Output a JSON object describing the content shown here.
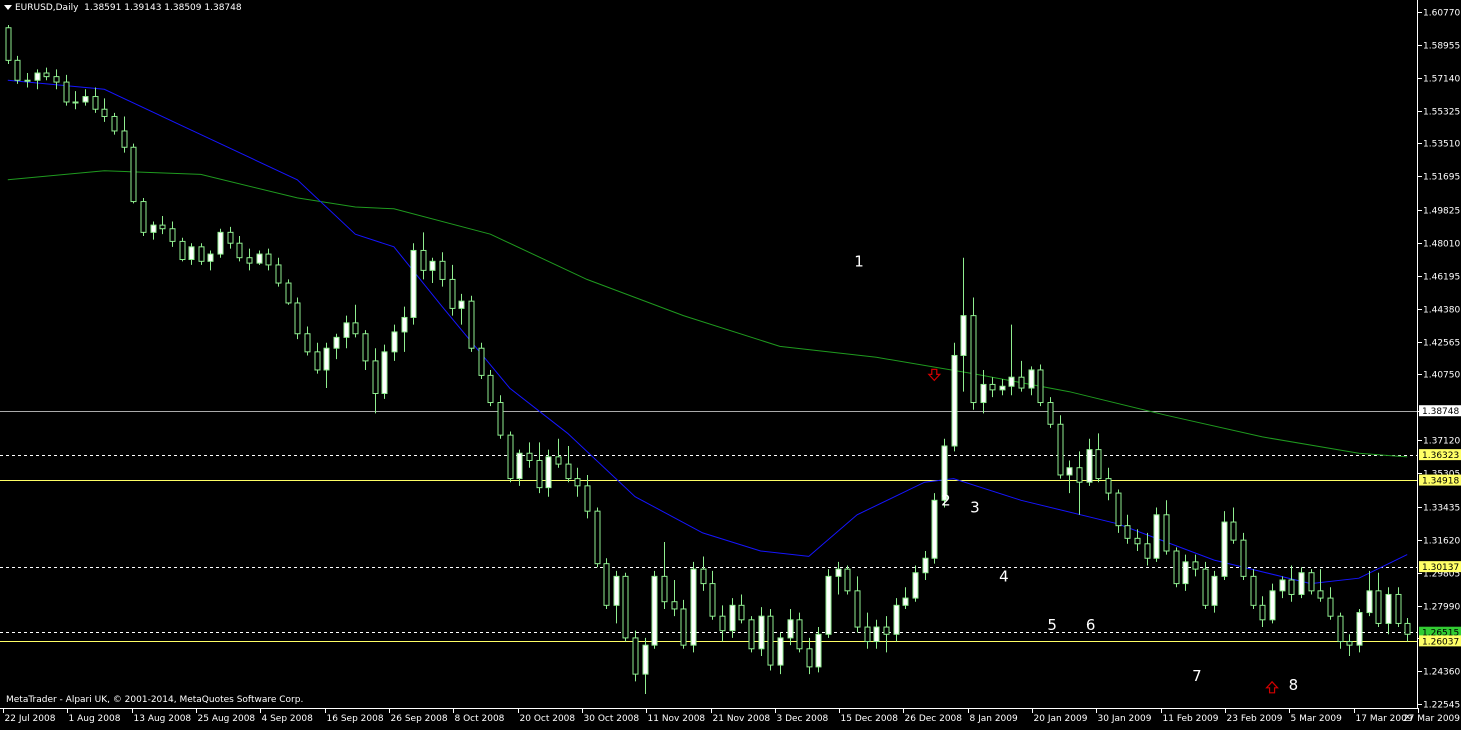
{
  "header": {
    "symbol": "EURUSD,Daily",
    "ohlc": "1.38591 1.39143 1.38509 1.38748"
  },
  "footer": {
    "copyright": "MetaTrader - Alpari UK, © 2001-2014, MetaQuotes Software Corp."
  },
  "colors": {
    "background": "#000000",
    "candle_bull": "#ffffff",
    "candle_bear": "#90ee90",
    "wick": "#90ee90",
    "ma_fast": "#1515ff",
    "ma_slow": "#1f9a1f",
    "hline_solid": "#aaaaaa",
    "hline_yellow": "#ffff66",
    "price_tag_yellow": "#ffff66",
    "price_tag_green": "#33cc33",
    "arrow_red": "#d00000"
  },
  "chart_data": {
    "type": "candlestick",
    "ylim": [
      1.2255,
      1.6077
    ],
    "y_ticks": [
      "1.60770",
      "1.58955",
      "1.57140",
      "1.55325",
      "1.53510",
      "1.51695",
      "1.49825",
      "1.48010",
      "1.46195",
      "1.44380",
      "1.42565",
      "1.40750",
      "1.38748",
      "1.37120",
      "1.35305",
      "1.33435",
      "1.31620",
      "1.29805",
      "1.27990",
      "1.26175",
      "1.24360",
      "1.22545"
    ],
    "x_ticks": [
      "22 Jul 2008",
      "1 Aug 2008",
      "13 Aug 2008",
      "25 Aug 2008",
      "4 Sep 2008",
      "16 Sep 2008",
      "26 Sep 2008",
      "8 Oct 2008",
      "20 Oct 2008",
      "30 Oct 2008",
      "11 Nov 2008",
      "21 Nov 2008",
      "3 Dec 2008",
      "15 Dec 2008",
      "26 Dec 2008",
      "8 Jan 2009",
      "20 Jan 2009",
      "30 Jan 2009",
      "11 Feb 2009",
      "23 Feb 2009",
      "5 Mar 2009",
      "17 Mar 2009",
      "27 Mar 2009"
    ],
    "price_tags": [
      {
        "label": "1.38748",
        "value": 1.38748,
        "style": "current"
      },
      {
        "label": "1.36323",
        "value": 1.36323,
        "style": "yellow"
      },
      {
        "label": "1.34918",
        "value": 1.34918,
        "style": "yellow"
      },
      {
        "label": "1.30137",
        "value": 1.30137,
        "style": "yellow"
      },
      {
        "label": "1.26515",
        "value": 1.26515,
        "style": "green"
      },
      {
        "label": "1.26037",
        "value": 1.26037,
        "style": "yellow"
      }
    ],
    "hlines": [
      {
        "value": 1.38748,
        "style": "solid-gray"
      },
      {
        "value": 1.36323,
        "style": "dashed"
      },
      {
        "value": 1.34918,
        "style": "solid-yellow"
      },
      {
        "value": 1.30137,
        "style": "dashed"
      },
      {
        "value": 1.26515,
        "style": "dashed"
      },
      {
        "value": 1.26037,
        "style": "solid-yellow"
      }
    ],
    "annotations": [
      {
        "text": "1",
        "date_index": 88,
        "price": 1.47
      },
      {
        "text": "2",
        "date_index": 97,
        "price": 1.338
      },
      {
        "text": "3",
        "date_index": 100,
        "price": 1.334
      },
      {
        "text": "4",
        "date_index": 103,
        "price": 1.296
      },
      {
        "text": "5",
        "date_index": 108,
        "price": 1.269
      },
      {
        "text": "6",
        "date_index": 112,
        "price": 1.269
      },
      {
        "text": "7",
        "date_index": 123,
        "price": 1.241
      },
      {
        "text": "8",
        "date_index": 133,
        "price": 1.236
      }
    ],
    "arrows": [
      {
        "direction": "down",
        "date_index": 96,
        "price": 1.407
      },
      {
        "direction": "up",
        "date_index": 131,
        "price": 1.235
      }
    ],
    "ma_fast": [
      [
        0,
        1.57
      ],
      [
        10,
        1.565
      ],
      [
        20,
        1.54
      ],
      [
        30,
        1.515
      ],
      [
        36,
        1.485
      ],
      [
        40,
        1.478
      ],
      [
        45,
        1.445
      ],
      [
        52,
        1.4
      ],
      [
        58,
        1.375
      ],
      [
        65,
        1.34
      ],
      [
        72,
        1.32
      ],
      [
        78,
        1.31
      ],
      [
        83,
        1.307
      ],
      [
        88,
        1.33
      ],
      [
        95,
        1.348
      ],
      [
        98,
        1.35
      ],
      [
        105,
        1.338
      ],
      [
        115,
        1.325
      ],
      [
        125,
        1.305
      ],
      [
        135,
        1.292
      ],
      [
        140,
        1.295
      ],
      [
        145,
        1.308
      ]
    ],
    "ma_slow": [
      [
        0,
        1.515
      ],
      [
        10,
        1.52
      ],
      [
        20,
        1.518
      ],
      [
        30,
        1.505
      ],
      [
        36,
        1.5
      ],
      [
        40,
        1.499
      ],
      [
        50,
        1.485
      ],
      [
        60,
        1.46
      ],
      [
        70,
        1.44
      ],
      [
        80,
        1.423
      ],
      [
        90,
        1.417
      ],
      [
        100,
        1.408
      ],
      [
        110,
        1.398
      ],
      [
        120,
        1.385
      ],
      [
        130,
        1.373
      ],
      [
        140,
        1.364
      ],
      [
        145,
        1.362
      ]
    ],
    "candles": [
      [
        1.599,
        1.6005,
        1.579,
        1.581
      ],
      [
        1.581,
        1.5835,
        1.568,
        1.57
      ],
      [
        1.57,
        1.574,
        1.566,
        1.57
      ],
      [
        1.57,
        1.576,
        1.565,
        1.574
      ],
      [
        1.574,
        1.577,
        1.57,
        1.572
      ],
      [
        1.572,
        1.576,
        1.565,
        1.569
      ],
      [
        1.569,
        1.573,
        1.556,
        1.558
      ],
      [
        1.558,
        1.564,
        1.554,
        1.558
      ],
      [
        1.558,
        1.565,
        1.556,
        1.561
      ],
      [
        1.561,
        1.566,
        1.552,
        1.554
      ],
      [
        1.554,
        1.56,
        1.547,
        1.55
      ],
      [
        1.55,
        1.552,
        1.54,
        1.542
      ],
      [
        1.542,
        1.55,
        1.53,
        1.533
      ],
      [
        1.533,
        1.535,
        1.502,
        1.503
      ],
      [
        1.503,
        1.505,
        1.484,
        1.486
      ],
      [
        1.486,
        1.492,
        1.482,
        1.49
      ],
      [
        1.49,
        1.495,
        1.485,
        1.488
      ],
      [
        1.488,
        1.492,
        1.478,
        1.481
      ],
      [
        1.481,
        1.483,
        1.47,
        1.471
      ],
      [
        1.471,
        1.48,
        1.468,
        1.478
      ],
      [
        1.478,
        1.48,
        1.468,
        1.47
      ],
      [
        1.47,
        1.476,
        1.465,
        1.474
      ],
      [
        1.474,
        1.488,
        1.472,
        1.486
      ],
      [
        1.486,
        1.489,
        1.477,
        1.48
      ],
      [
        1.48,
        1.484,
        1.47,
        1.472
      ],
      [
        1.472,
        1.477,
        1.465,
        1.469
      ],
      [
        1.469,
        1.476,
        1.468,
        1.474
      ],
      [
        1.474,
        1.477,
        1.465,
        1.468
      ],
      [
        1.468,
        1.472,
        1.456,
        1.458
      ],
      [
        1.458,
        1.46,
        1.446,
        1.447
      ],
      [
        1.447,
        1.45,
        1.427,
        1.43
      ],
      [
        1.43,
        1.434,
        1.418,
        1.42
      ],
      [
        1.42,
        1.425,
        1.408,
        1.41
      ],
      [
        1.41,
        1.425,
        1.4,
        1.422
      ],
      [
        1.422,
        1.43,
        1.416,
        1.428
      ],
      [
        1.428,
        1.44,
        1.422,
        1.436
      ],
      [
        1.436,
        1.446,
        1.428,
        1.43
      ],
      [
        1.43,
        1.432,
        1.41,
        1.415
      ],
      [
        1.415,
        1.422,
        1.386,
        1.397
      ],
      [
        1.397,
        1.424,
        1.394,
        1.42
      ],
      [
        1.42,
        1.435,
        1.415,
        1.431
      ],
      [
        1.431,
        1.445,
        1.42,
        1.439
      ],
      [
        1.439,
        1.48,
        1.435,
        1.476
      ],
      [
        1.476,
        1.486,
        1.46,
        1.465
      ],
      [
        1.465,
        1.472,
        1.458,
        1.47
      ],
      [
        1.47,
        1.475,
        1.456,
        1.46
      ],
      [
        1.46,
        1.468,
        1.44,
        1.444
      ],
      [
        1.444,
        1.452,
        1.435,
        1.448
      ],
      [
        1.448,
        1.451,
        1.42,
        1.422
      ],
      [
        1.422,
        1.425,
        1.405,
        1.407
      ],
      [
        1.407,
        1.41,
        1.39,
        1.392
      ],
      [
        1.392,
        1.396,
        1.372,
        1.374
      ],
      [
        1.374,
        1.376,
        1.348,
        1.35
      ],
      [
        1.35,
        1.366,
        1.346,
        1.364
      ],
      [
        1.364,
        1.37,
        1.356,
        1.36
      ],
      [
        1.36,
        1.37,
        1.342,
        1.345
      ],
      [
        1.345,
        1.366,
        1.34,
        1.362
      ],
      [
        1.362,
        1.372,
        1.356,
        1.358
      ],
      [
        1.358,
        1.368,
        1.348,
        1.35
      ],
      [
        1.35,
        1.356,
        1.34,
        1.346
      ],
      [
        1.346,
        1.352,
        1.328,
        1.332
      ],
      [
        1.332,
        1.334,
        1.301,
        1.303
      ],
      [
        1.303,
        1.306,
        1.278,
        1.28
      ],
      [
        1.28,
        1.299,
        1.27,
        1.296
      ],
      [
        1.296,
        1.298,
        1.26,
        1.262
      ],
      [
        1.262,
        1.266,
        1.238,
        1.242
      ],
      [
        1.242,
        1.262,
        1.231,
        1.258
      ],
      [
        1.258,
        1.299,
        1.256,
        1.296
      ],
      [
        1.296,
        1.315,
        1.278,
        1.282
      ],
      [
        1.282,
        1.294,
        1.274,
        1.278
      ],
      [
        1.278,
        1.283,
        1.256,
        1.258
      ],
      [
        1.258,
        1.304,
        1.254,
        1.3
      ],
      [
        1.3,
        1.307,
        1.288,
        1.292
      ],
      [
        1.292,
        1.299,
        1.272,
        1.274
      ],
      [
        1.274,
        1.28,
        1.26,
        1.266
      ],
      [
        1.266,
        1.284,
        1.262,
        1.28
      ],
      [
        1.28,
        1.286,
        1.27,
        1.272
      ],
      [
        1.272,
        1.274,
        1.254,
        1.256
      ],
      [
        1.256,
        1.279,
        1.252,
        1.274
      ],
      [
        1.274,
        1.278,
        1.244,
        1.247
      ],
      [
        1.247,
        1.265,
        1.242,
        1.262
      ],
      [
        1.262,
        1.278,
        1.258,
        1.272
      ],
      [
        1.272,
        1.276,
        1.254,
        1.256
      ],
      [
        1.256,
        1.262,
        1.242,
        1.246
      ],
      [
        1.246,
        1.268,
        1.243,
        1.264
      ],
      [
        1.264,
        1.3,
        1.262,
        1.296
      ],
      [
        1.296,
        1.304,
        1.286,
        1.3
      ],
      [
        1.3,
        1.302,
        1.286,
        1.288
      ],
      [
        1.288,
        1.296,
        1.265,
        1.268
      ],
      [
        1.268,
        1.276,
        1.256,
        1.26
      ],
      [
        1.26,
        1.272,
        1.256,
        1.268
      ],
      [
        1.268,
        1.274,
        1.254,
        1.264
      ],
      [
        1.264,
        1.284,
        1.26,
        1.28
      ],
      [
        1.28,
        1.29,
        1.278,
        1.284
      ],
      [
        1.284,
        1.302,
        1.282,
        1.298
      ],
      [
        1.298,
        1.31,
        1.294,
        1.306
      ],
      [
        1.306,
        1.342,
        1.303,
        1.338
      ],
      [
        1.338,
        1.372,
        1.334,
        1.368
      ],
      [
        1.368,
        1.425,
        1.365,
        1.418
      ],
      [
        1.418,
        1.472,
        1.398,
        1.44
      ],
      [
        1.44,
        1.45,
        1.388,
        1.392
      ],
      [
        1.392,
        1.41,
        1.386,
        1.402
      ],
      [
        1.402,
        1.406,
        1.395,
        1.399
      ],
      [
        1.399,
        1.405,
        1.396,
        1.401
      ],
      [
        1.401,
        1.435,
        1.396,
        1.406
      ],
      [
        1.406,
        1.415,
        1.398,
        1.4
      ],
      [
        1.4,
        1.412,
        1.396,
        1.41
      ],
      [
        1.41,
        1.413,
        1.39,
        1.392
      ],
      [
        1.392,
        1.395,
        1.378,
        1.38
      ],
      [
        1.38,
        1.385,
        1.35,
        1.352
      ]
    ]
  }
}
